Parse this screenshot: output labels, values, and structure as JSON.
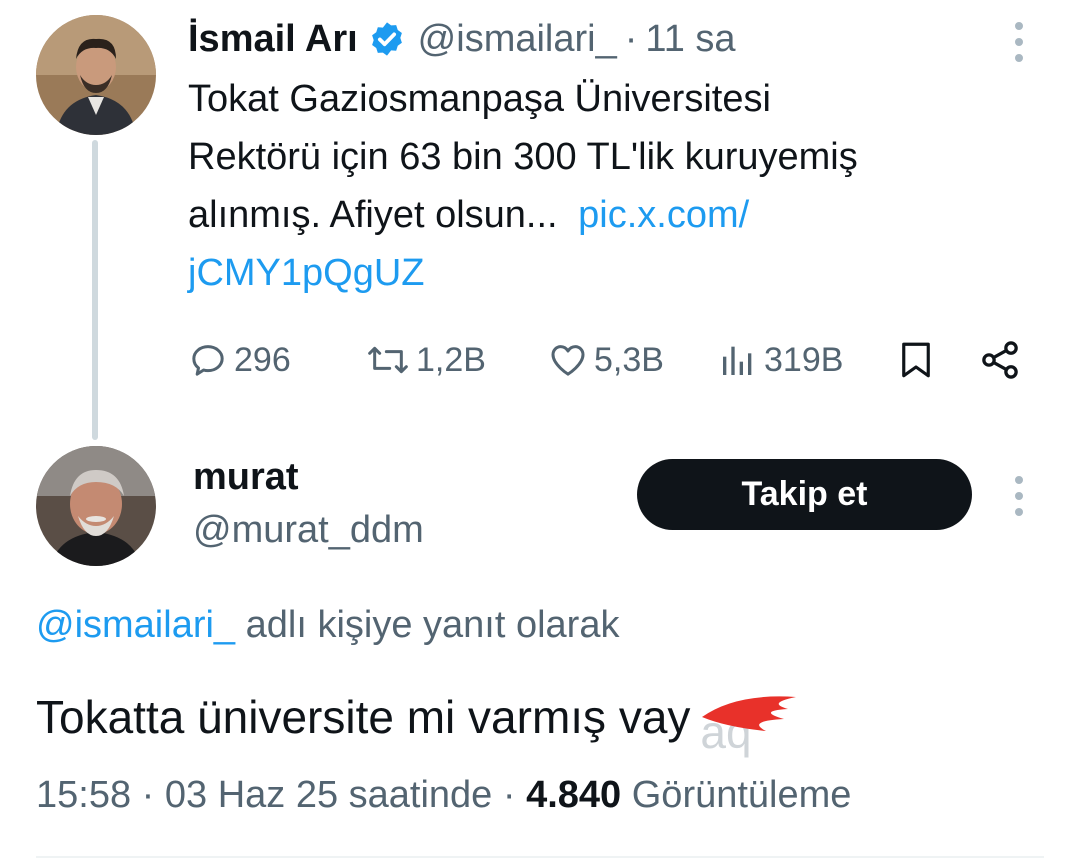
{
  "original_tweet": {
    "author_name": "İsmail Arı",
    "handle": "@ismailari_",
    "separator": "·",
    "time_ago": "11 sa",
    "text_line1": "Tokat Gaziosmanpaşa Üniversitesi",
    "text_line2": "Rektörü için 63 bin 300 TL'lik kuruyemiş",
    "text_line3": "alınmış. Afiyet olsun...",
    "link_part1": "pic.x.com/",
    "link_part2": "jCMY1pQgUZ",
    "replies": "296",
    "reposts": "1,2B",
    "likes": "5,3B",
    "views": "319B"
  },
  "reply": {
    "author_name": "murat",
    "handle": "@murat_ddm",
    "follow_label": "Takip et",
    "reply_to_handle": "@ismailari_",
    "reply_to_suffix": "adlı kişiye yanıt olarak",
    "text": "Tokatta üniversite mi varmış vay",
    "time": "15:58 · 03 Haz 25 saatinde ·",
    "view_count": "4.840",
    "view_label": "Görüntüleme"
  },
  "colors": {
    "accent": "#1d9bf0",
    "text": "#0f1419",
    "muted": "#536471",
    "redaction": "#e8312a"
  },
  "icons": [
    "verified-badge-icon",
    "reply-icon",
    "repost-icon",
    "like-icon",
    "views-icon",
    "bookmark-icon",
    "share-icon",
    "more-icon"
  ]
}
